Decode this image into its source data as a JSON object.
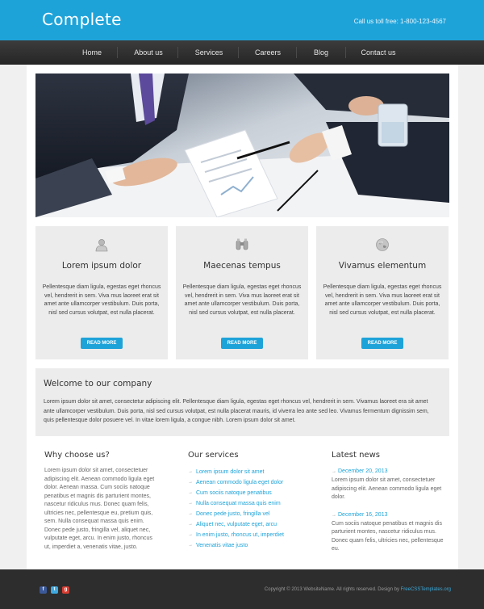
{
  "header": {
    "logo": "Complete",
    "phone": "Call us toll free: 1-800-123-4567"
  },
  "nav": {
    "items": [
      "Home",
      "About us",
      "Services",
      "Careers",
      "Blog",
      "Contact us"
    ]
  },
  "features": [
    {
      "icon": "user-icon",
      "title": "Lorem ipsum dolor",
      "text": "Pellentesque diam ligula, egestas eget rhoncus vel, hendrerit in sem. Viva mus laoreet erat sit amet ante ullamcorper vestibulum. Duis porta, nisl sed cursus volutpat, est nulla placerat.",
      "button": "READ MORE"
    },
    {
      "icon": "binoculars-icon",
      "title": "Maecenas tempus",
      "text": "Pellentesque diam ligula, egestas eget rhoncus vel, hendrerit in sem. Viva mus laoreet erat sit amet ante ullamcorper vestibulum. Duis porta, nisl sed cursus volutpat, est nulla placerat.",
      "button": "READ MORE"
    },
    {
      "icon": "globe-icon",
      "title": "Vivamus elementum",
      "text": "Pellentesque diam ligula, egestas eget rhoncus vel, hendrerit in sem. Viva mus laoreet erat sit amet ante ullamcorper vestibulum. Duis porta, nisl sed cursus volutpat, est nulla placerat.",
      "button": "READ MORE"
    }
  ],
  "welcome": {
    "title": "Welcome to our company",
    "text": "Lorem ipsum dolor sit amet, consectetur adipiscing elit. Pellentesque diam ligula, egestas eget rhoncus vel, hendrerit in sem. Vivamus laoreet era sit amet ante ullamcorper vestibulum. Duis porta, nisl sed cursus volutpat, est nulla placerat mauris, id viverra leo ante sed leo. Vivamus fermentum dignissim sem, quis pellentesque dolor posuere vel. In vitae lorem ligula, a congue nibh. Lorem ipsum dolor sit amet."
  },
  "why": {
    "title": "Why choose us?",
    "text": "Lorem ipsum dolor sit amet, consectetuer adipiscing elit. Aenean commodo ligula eget dolor. Aenean massa. Cum sociis natoque penatibus et magnis dis parturient montes, nascetur ridiculus mus. Donec quam felis, ultricies nec, pellentesque eu, pretium quis, sem. Nulla consequat massa quis enim. Donec pede justo, fringilla vel, aliquet nec, vulputate eget, arcu. In enim justo, rhoncus ut, imperdiet a, venenatis vitae, justo."
  },
  "services": {
    "title": "Our services",
    "items": [
      "Lorem ipsum dolor sit amet",
      "Aenean commodo ligula eget dolor",
      "Cum sociis natoque penatibus",
      "Nulla consequat massa quis enim",
      "Donec pede justo, fringilla vel",
      "Aliquet nec, vulputate eget, arcu",
      "In enim justo, rhoncus ut, imperdiet",
      "Venenatis vitae justo"
    ]
  },
  "news": {
    "title": "Latest news",
    "items": [
      {
        "date": "December 20, 2013",
        "text": "Lorem ipsum dolor sit amet, consectetuer adipiscing elit. Aenean commodo ligula eget dolor."
      },
      {
        "date": "December 16, 2013",
        "text": "Cum sociis natoque penatibus et magnis dis parturient montes, nascetur ridiculus mus. Donec quam felis, ultricies nec, pellentesque eu."
      }
    ]
  },
  "footer": {
    "copyright": "Copyright © 2013 WebsiteName. All rights reserved. Design by ",
    "designer": "FreeCSSTemplates.org",
    "social": [
      {
        "icon": "facebook-icon",
        "glyph": "f",
        "color": "#3b5998"
      },
      {
        "icon": "twitter-icon",
        "glyph": "t",
        "color": "#3ea9e0"
      },
      {
        "icon": "googleplus-icon",
        "glyph": "g",
        "color": "#d73d32"
      }
    ]
  },
  "colors": {
    "accent": "#1ea3d9",
    "nav_bg": "#2e2e2e",
    "footer_bg": "#2d2d2d"
  }
}
